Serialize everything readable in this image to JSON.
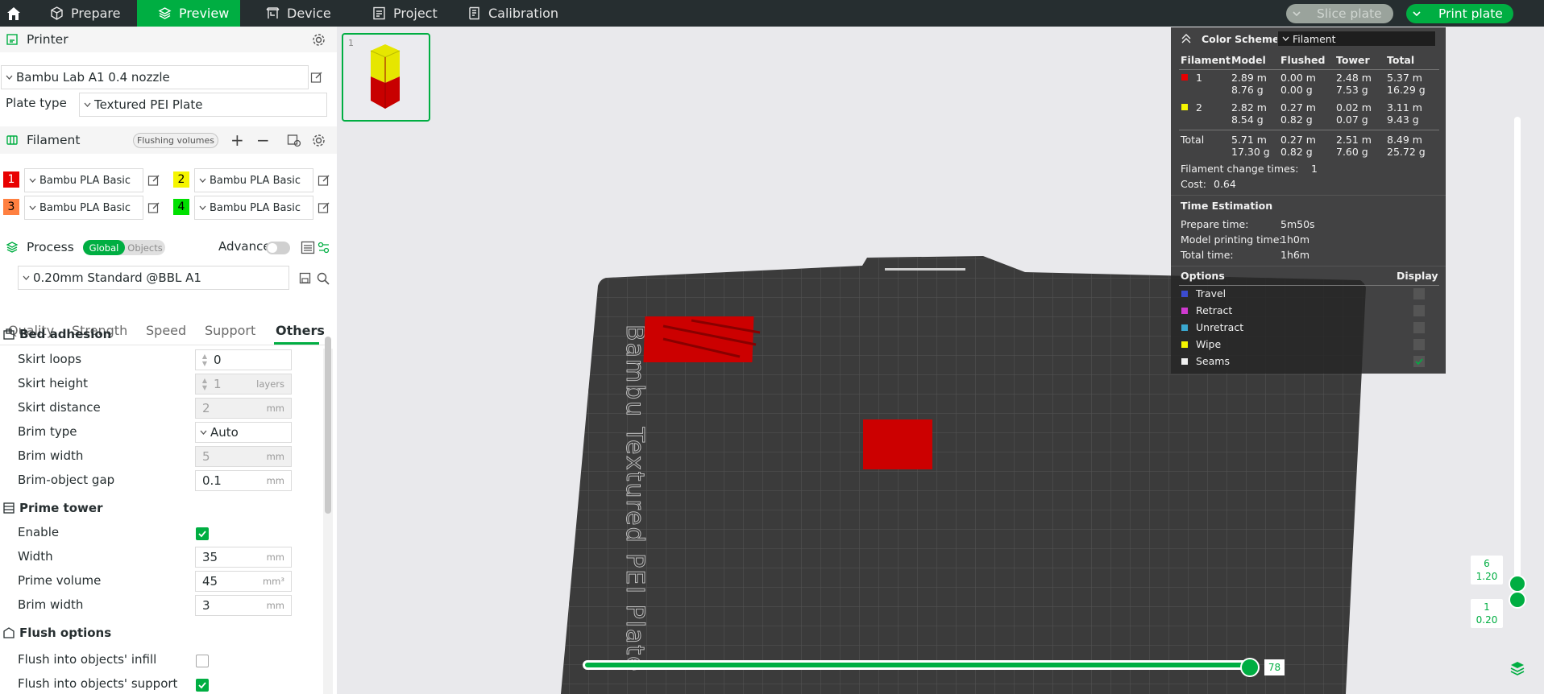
{
  "topbar": {
    "tabs": [
      "Prepare",
      "Preview",
      "Device",
      "Project",
      "Calibration"
    ],
    "slice_label": "Slice plate",
    "print_label": "Print plate"
  },
  "printer": {
    "section_title": "Printer",
    "name": "Bambu Lab A1 0.4 nozzle",
    "plate_type_label": "Plate type",
    "plate_type": "Textured PEI Plate"
  },
  "filament": {
    "section_title": "Filament",
    "flushing_label": "Flushing volumes",
    "items": [
      {
        "num": "1",
        "color": "#e80000",
        "name": "Bambu PLA Basic"
      },
      {
        "num": "2",
        "color": "#f5f500",
        "name": "Bambu PLA Basic"
      },
      {
        "num": "3",
        "color": "#ff8040",
        "name": "Bambu PLA Basic"
      },
      {
        "num": "4",
        "color": "#00e000",
        "name": "Bambu PLA Basic"
      }
    ]
  },
  "process": {
    "section_title": "Process",
    "global_label": "Global",
    "objects_label": "Objects",
    "advance_label": "Advance",
    "preset": "0.20mm Standard @BBL A1",
    "tabs": [
      "Quality",
      "Strength",
      "Speed",
      "Support",
      "Others"
    ]
  },
  "params": {
    "bed_adhesion": {
      "title": "Bed adhesion",
      "skirt_loops": {
        "label": "Skirt loops",
        "value": "0"
      },
      "skirt_height": {
        "label": "Skirt height",
        "value": "1",
        "unit": "layers"
      },
      "skirt_distance": {
        "label": "Skirt distance",
        "value": "2",
        "unit": "mm"
      },
      "brim_type": {
        "label": "Brim type",
        "value": "Auto"
      },
      "brim_width": {
        "label": "Brim width",
        "value": "5",
        "unit": "mm"
      },
      "brim_gap": {
        "label": "Brim-object gap",
        "value": "0.1",
        "unit": "mm"
      }
    },
    "prime_tower": {
      "title": "Prime tower",
      "enable": {
        "label": "Enable"
      },
      "width": {
        "label": "Width",
        "value": "35",
        "unit": "mm"
      },
      "volume": {
        "label": "Prime volume",
        "value": "45",
        "unit": "mm³"
      },
      "brim_width": {
        "label": "Brim width",
        "value": "3",
        "unit": "mm"
      }
    },
    "flush": {
      "title": "Flush options",
      "infill": {
        "label": "Flush into objects' infill"
      },
      "support": {
        "label": "Flush into objects' support"
      }
    }
  },
  "plate": {
    "text": "Bambu Textured PEI Plate"
  },
  "legend": {
    "title": "Color Scheme",
    "scheme": "Filament",
    "headers": [
      "Filament",
      "Model",
      "Flushed",
      "Tower",
      "Total"
    ],
    "rows": [
      {
        "id": "1",
        "color": "#e80000",
        "model_m": "2.89 m",
        "model_g": "8.76 g",
        "flushed_m": "0.00 m",
        "flushed_g": "0.00 g",
        "tower_m": "2.48 m",
        "tower_g": "7.53 g",
        "total_m": "5.37 m",
        "total_g": "16.29 g"
      },
      {
        "id": "2",
        "color": "#f5f500",
        "model_m": "2.82 m",
        "model_g": "8.54 g",
        "flushed_m": "0.27 m",
        "flushed_g": "0.82 g",
        "tower_m": "0.02 m",
        "tower_g": "0.07 g",
        "total_m": "3.11 m",
        "total_g": "9.43 g"
      }
    ],
    "total": {
      "label": "Total",
      "model_m": "5.71 m",
      "model_g": "17.30 g",
      "flushed_m": "0.27 m",
      "flushed_g": "0.82 g",
      "tower_m": "2.51 m",
      "tower_g": "7.60 g",
      "total_m": "8.49 m",
      "total_g": "25.72 g"
    },
    "change_label": "Filament change times:",
    "change_value": "1",
    "cost_label": "Cost:",
    "cost_value": "0.64",
    "time_title": "Time Estimation",
    "prepare_label": "Prepare time:",
    "prepare_value": "5m50s",
    "model_time_label": "Model printing time:",
    "model_time_value": "1h0m",
    "total_time_label": "Total time:",
    "total_time_value": "1h6m",
    "options_title": "Options",
    "display_title": "Display",
    "options": [
      {
        "name": "Travel",
        "color": "#3b4bd0"
      },
      {
        "name": "Retract",
        "color": "#d03ad0"
      },
      {
        "name": "Unretract",
        "color": "#3aa8d0"
      },
      {
        "name": "Wipe",
        "color": "#f5f500"
      },
      {
        "name": "Seams",
        "color": "#f0f0f0"
      }
    ]
  },
  "layers": {
    "top_layer": "6",
    "top_height": "1.20",
    "bottom_layer": "1",
    "bottom_height": "0.20"
  },
  "moves": {
    "value": "78"
  }
}
